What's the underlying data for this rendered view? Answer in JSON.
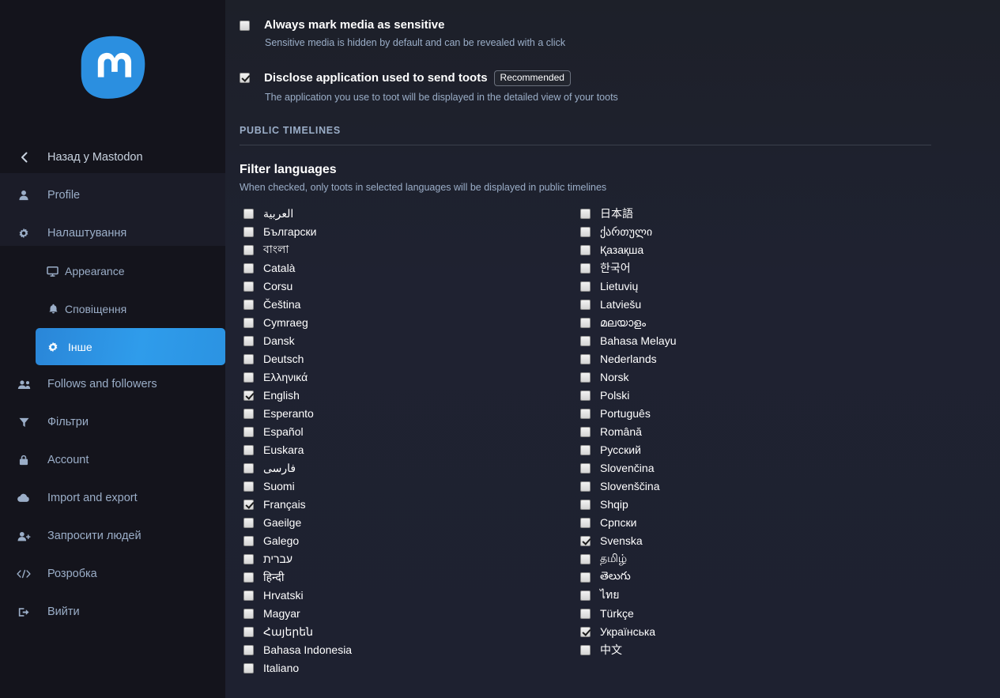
{
  "sidebar": {
    "logo_alt": "mastodon-logo",
    "items": [
      {
        "label": "Назад у Mastodon",
        "icon": "chevron-left-icon",
        "name": "back-to-mastodon",
        "active": false,
        "sub": false
      },
      {
        "label": "Profile",
        "icon": "user-icon",
        "name": "profile",
        "active": false,
        "sub": false
      },
      {
        "label": "Налаштування",
        "icon": "gear-icon",
        "name": "preferences",
        "active": false,
        "sub": false
      },
      {
        "label": "Appearance",
        "icon": "monitor-icon",
        "name": "appearance",
        "active": false,
        "sub": true
      },
      {
        "label": "Сповіщення",
        "icon": "bell-icon",
        "name": "notifications",
        "active": false,
        "sub": true
      },
      {
        "label": "Інше",
        "icon": "gear-icon",
        "name": "other",
        "active": true,
        "sub": true
      },
      {
        "label": "Follows and followers",
        "icon": "users-icon",
        "name": "follows-and-followers",
        "active": false,
        "sub": false
      },
      {
        "label": "Фільтри",
        "icon": "filter-icon",
        "name": "filters",
        "active": false,
        "sub": false
      },
      {
        "label": "Account",
        "icon": "lock-icon",
        "name": "account",
        "active": false,
        "sub": false
      },
      {
        "label": "Import and export",
        "icon": "cloud-icon",
        "name": "import-and-export",
        "active": false,
        "sub": false
      },
      {
        "label": "Запросити людей",
        "icon": "user-plus-icon",
        "name": "invite-people",
        "active": false,
        "sub": false
      },
      {
        "label": "Розробка",
        "icon": "code-icon",
        "name": "development",
        "active": false,
        "sub": false
      },
      {
        "label": "Вийти",
        "icon": "sign-out-icon",
        "name": "logout",
        "active": false,
        "sub": false
      }
    ]
  },
  "main": {
    "toggles": [
      {
        "title": "Always mark media as sensitive",
        "hint": "Sensitive media is hidden by default and can be revealed with a click",
        "checked": false,
        "badge": null,
        "name": "always-mark-media-as-sensitive"
      },
      {
        "title": "Disclose application used to send toots",
        "hint": "The application you use to toot will be displayed in the detailed view of your toots",
        "checked": true,
        "badge": "Recommended",
        "name": "disclose-application-used-to-send-toots"
      }
    ],
    "section_header": "PUBLIC TIMELINES",
    "field_title": "Filter languages",
    "field_hint": "When checked, only toots in selected languages will be displayed in public timelines",
    "languages_left": [
      {
        "label": "العربية",
        "checked": false
      },
      {
        "label": "Български",
        "checked": false
      },
      {
        "label": "বাংলা",
        "checked": false
      },
      {
        "label": "Català",
        "checked": false
      },
      {
        "label": "Corsu",
        "checked": false
      },
      {
        "label": "Čeština",
        "checked": false
      },
      {
        "label": "Cymraeg",
        "checked": false
      },
      {
        "label": "Dansk",
        "checked": false
      },
      {
        "label": "Deutsch",
        "checked": false
      },
      {
        "label": "Ελληνικά",
        "checked": false
      },
      {
        "label": "English",
        "checked": true
      },
      {
        "label": "Esperanto",
        "checked": false
      },
      {
        "label": "Español",
        "checked": false
      },
      {
        "label": "Euskara",
        "checked": false
      },
      {
        "label": "فارسی",
        "checked": false
      },
      {
        "label": "Suomi",
        "checked": false
      },
      {
        "label": "Français",
        "checked": true
      },
      {
        "label": "Gaeilge",
        "checked": false
      },
      {
        "label": "Galego",
        "checked": false
      },
      {
        "label": "עברית",
        "checked": false
      },
      {
        "label": "हिन्दी",
        "checked": false
      },
      {
        "label": "Hrvatski",
        "checked": false
      },
      {
        "label": "Magyar",
        "checked": false
      },
      {
        "label": "Հայերեն",
        "checked": false
      },
      {
        "label": "Bahasa Indonesia",
        "checked": false
      },
      {
        "label": "Italiano",
        "checked": false
      }
    ],
    "languages_right": [
      {
        "label": "日本語",
        "checked": false
      },
      {
        "label": "ქართული",
        "checked": false
      },
      {
        "label": "Қазақша",
        "checked": false
      },
      {
        "label": "한국어",
        "checked": false
      },
      {
        "label": "Lietuvių",
        "checked": false
      },
      {
        "label": "Latviešu",
        "checked": false
      },
      {
        "label": "മലയാളം",
        "checked": false
      },
      {
        "label": "Bahasa Melayu",
        "checked": false
      },
      {
        "label": "Nederlands",
        "checked": false
      },
      {
        "label": "Norsk",
        "checked": false
      },
      {
        "label": "Polski",
        "checked": false
      },
      {
        "label": "Português",
        "checked": false
      },
      {
        "label": "Română",
        "checked": false
      },
      {
        "label": "Русский",
        "checked": false
      },
      {
        "label": "Slovenčina",
        "checked": false
      },
      {
        "label": "Slovenščina",
        "checked": false
      },
      {
        "label": "Shqip",
        "checked": false
      },
      {
        "label": "Српски",
        "checked": false
      },
      {
        "label": "Svenska",
        "checked": true
      },
      {
        "label": "தமிழ்",
        "checked": false
      },
      {
        "label": "తెలుగు",
        "checked": false
      },
      {
        "label": "ไทย",
        "checked": false
      },
      {
        "label": "Türkçe",
        "checked": false
      },
      {
        "label": "Українська",
        "checked": true
      },
      {
        "label": "中文",
        "checked": false
      }
    ]
  },
  "colors": {
    "accent": "#2b90d9",
    "sidebar_bg": "#14141c",
    "main_bg": "#1f2230",
    "muted_text": "#9baec8",
    "text": "#ffffff"
  }
}
